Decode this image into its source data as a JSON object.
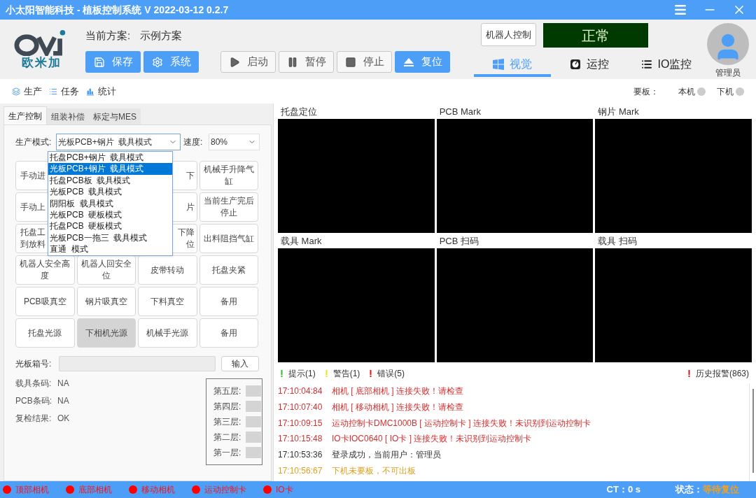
{
  "window": {
    "title": "小太阳智能科技 - 植板控制系统  V 2022-03-12 0.2.7"
  },
  "header": {
    "logo_text": "欧米加",
    "plan_label": "当前方案:",
    "plan_value": "示例方案",
    "buttons": [
      {
        "label": "保存",
        "kind": "save"
      },
      {
        "label": "系统",
        "kind": "system"
      },
      {
        "label": "启动",
        "kind": "start"
      },
      {
        "label": "暂停",
        "kind": "pause"
      },
      {
        "label": "停止",
        "kind": "stop"
      },
      {
        "label": "复位",
        "kind": "reset"
      }
    ],
    "robot_button": "机器人控制",
    "status": "正常",
    "tabs": [
      {
        "label": "视觉",
        "kind": "windows",
        "selected": true
      },
      {
        "label": "运控",
        "kind": "gauge",
        "selected": false
      },
      {
        "label": "IO监控",
        "kind": "list",
        "selected": false
      }
    ],
    "user": "管理员"
  },
  "nav": {
    "items": [
      {
        "label": "生产",
        "kind": "layers"
      },
      {
        "label": "任务",
        "kind": "list"
      },
      {
        "label": "统计",
        "kind": "chart"
      }
    ],
    "board_label": "要板：",
    "indicators": [
      {
        "label": "本机",
        "on": false
      },
      {
        "label": "下机",
        "on": false
      }
    ]
  },
  "left_panel": {
    "tabs": [
      {
        "label": "生产控制",
        "selected": true
      },
      {
        "label": "组装补偿",
        "selected": false
      },
      {
        "label": "标定与MES",
        "selected": false
      }
    ],
    "mode_label": "生产模式:",
    "mode_value": "光板PCB+钢片  载具模式",
    "speed_label": "速度:",
    "speed_value": "80%",
    "mode_options": [
      {
        "label": "托盘PCB+钢片  载具模式",
        "selected": false
      },
      {
        "label": "光板PCB+钢片  载具模式",
        "selected": true
      },
      {
        "label": "托盘PCB板  载具模式",
        "selected": false
      },
      {
        "label": "光板PCB  载具模式",
        "selected": false
      },
      {
        "label": "阴阳板  载具模式",
        "selected": false
      },
      {
        "label": "光板PCB  硬板模式",
        "selected": false
      },
      {
        "label": "托盘PCB  硬板模式",
        "selected": false
      },
      {
        "label": "光板PCB一拖三  载具模式",
        "selected": false
      },
      {
        "label": "直通  模式",
        "selected": false
      }
    ],
    "button_rows": [
      [
        {
          "kind": "cut_right",
          "label": "手动进",
          "on": false
        },
        {
          "kind": "covered"
        },
        {
          "kind": "cut_left",
          "label": "下",
          "on": false
        },
        {
          "kind": "button",
          "label": "机械手升降气缸",
          "on": false
        }
      ],
      [
        {
          "kind": "cut_right",
          "label": "手动上",
          "on": false
        },
        {
          "kind": "covered"
        },
        {
          "kind": "cut_left",
          "label": "片",
          "on": false
        },
        {
          "kind": "button",
          "label": "当前生产完后停止",
          "on": false
        }
      ],
      [
        {
          "kind": "cut_right",
          "label": "托盘工到放料",
          "on": false
        },
        {
          "kind": "covered"
        },
        {
          "kind": "cut_left",
          "label": "下降位",
          "on": false
        },
        {
          "kind": "button",
          "label": "出料阻挡气缸",
          "on": false
        }
      ],
      [
        {
          "kind": "button",
          "label": "机器人安全高度",
          "on": false
        },
        {
          "kind": "button",
          "label": "机器人回安全位",
          "on": false
        },
        {
          "kind": "button",
          "label": "皮带转动",
          "on": false
        },
        {
          "kind": "button",
          "label": "托盘夹紧",
          "on": false
        }
      ],
      [
        {
          "kind": "button",
          "label": "PCB吸真空",
          "on": false
        },
        {
          "kind": "button",
          "label": "钢片吸真空",
          "on": false
        },
        {
          "kind": "button",
          "label": "下料真空",
          "on": false
        },
        {
          "kind": "button",
          "label": "备用",
          "on": false
        }
      ],
      [
        {
          "kind": "button",
          "label": "托盘光源",
          "on": false
        },
        {
          "kind": "button",
          "label": "下相机光源",
          "on": true
        },
        {
          "kind": "button",
          "label": "机械手光源",
          "on": false
        },
        {
          "kind": "button",
          "label": "备用",
          "on": false
        }
      ]
    ],
    "box_label": "光板箱号:",
    "input_button": "输入",
    "fields": [
      {
        "label": "载具条码:",
        "value": "NA"
      },
      {
        "label": "PCB条码:",
        "value": "NA"
      },
      {
        "label": "复检结果:",
        "value": "OK"
      }
    ],
    "layers": [
      {
        "label": "第五层:",
        "lit": false
      },
      {
        "label": "第四层:",
        "lit": false
      },
      {
        "label": "第三层:",
        "lit": false
      },
      {
        "label": "第二层:",
        "lit": false
      },
      {
        "label": "第一层:",
        "lit": false
      }
    ]
  },
  "cameras": [
    {
      "title": "托盘定位"
    },
    {
      "title": "PCB Mark"
    },
    {
      "title": "钢片 Mark"
    },
    {
      "title": "载具 Mark"
    },
    {
      "title": "PCB 扫码"
    },
    {
      "title": "载具 扫码"
    }
  ],
  "log": {
    "filters": [
      {
        "label": "提示(1)",
        "color": "#22c322"
      },
      {
        "label": "警告(1)",
        "color": "#e8e800"
      },
      {
        "label": "错误(5)",
        "color": "#e01010"
      }
    ],
    "history": "历史报警(863)",
    "entries": [
      {
        "time": "17:10:04:84",
        "text": "相机 [ 底部相机 ] 连接失败！请检查",
        "kind": "error"
      },
      {
        "time": "17:10:07:40",
        "text": "相机 [ 移动相机 ] 连接失败！请检查",
        "kind": "error"
      },
      {
        "time": "17:10:09:15",
        "text": "运动控制卡DMC1000B [ 运动控制卡 ] 连接失败！未识别到运动控制卡",
        "kind": "error"
      },
      {
        "time": "17:10:15:48",
        "text": "IO卡IOC0640 [ IO卡 ] 连接失败！未识别到运动控制卡",
        "kind": "error"
      },
      {
        "time": "17:10:53:36",
        "text": "登录成功，当前用户：管理员",
        "kind": "info"
      },
      {
        "time": "17:10:56:67",
        "text": "下机未要板，不可出板",
        "kind": "warning"
      }
    ]
  },
  "status_bar": {
    "devices": [
      {
        "label": "顶部相机",
        "connected": false
      },
      {
        "label": "底部相机",
        "connected": false
      },
      {
        "label": "移动相机",
        "connected": false
      },
      {
        "label": "运动控制卡",
        "connected": false
      },
      {
        "label": "IO卡",
        "connected": false
      }
    ],
    "ct": "CT：0 s",
    "state_label": "状态：",
    "state_value": "等待复位"
  }
}
